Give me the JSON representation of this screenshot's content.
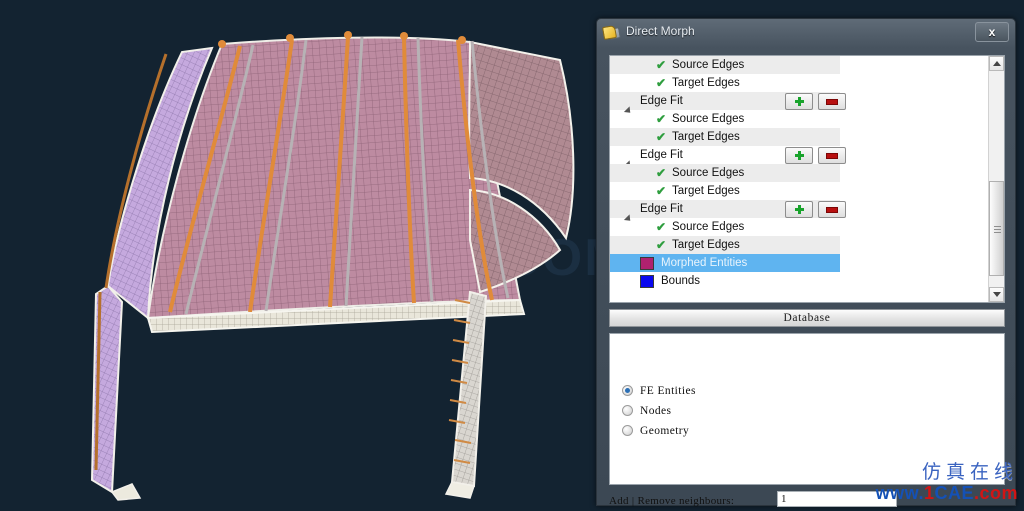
{
  "viewport": {
    "name": "3d-model-viewport",
    "background_color": "#132331",
    "watermark": "CAE.COM",
    "model_description": "FE mesh of an automotive roof / body-in-white panel with side rails",
    "mesh_colors": {
      "shell_panel": "#c08ba0",
      "ribs": "#e08b3a",
      "rails": "#b7aeb8",
      "left_pillar": "#c3a8dc",
      "highlight_edges": "#f2f0ea"
    }
  },
  "dialog": {
    "title": "Direct Morph",
    "icon": "morph-tag-icon",
    "close_label": "x",
    "tree": {
      "rows": [
        {
          "type": "check",
          "indent": 44,
          "label": "Source Edges",
          "alt": true,
          "selected": false
        },
        {
          "type": "check",
          "indent": 44,
          "label": "Target Edges",
          "alt": false,
          "selected": false
        },
        {
          "type": "arrow",
          "indent": 12,
          "label": "Edge Fit",
          "alt": true,
          "selected": false,
          "buttons": [
            "add",
            "remove"
          ]
        },
        {
          "type": "check",
          "indent": 44,
          "label": "Source Edges",
          "alt": false,
          "selected": false
        },
        {
          "type": "check",
          "indent": 44,
          "label": "Target Edges",
          "alt": true,
          "selected": false
        },
        {
          "type": "arrow",
          "indent": 12,
          "label": "Edge Fit",
          "alt": false,
          "selected": false,
          "buttons": [
            "add",
            "remove"
          ]
        },
        {
          "type": "check",
          "indent": 44,
          "label": "Source Edges",
          "alt": true,
          "selected": false
        },
        {
          "type": "check",
          "indent": 44,
          "label": "Target Edges",
          "alt": false,
          "selected": false
        },
        {
          "type": "arrow",
          "indent": 12,
          "label": "Edge Fit",
          "alt": true,
          "selected": false,
          "buttons": [
            "add",
            "remove"
          ]
        },
        {
          "type": "check",
          "indent": 44,
          "label": "Source Edges",
          "alt": false,
          "selected": false
        },
        {
          "type": "check",
          "indent": 44,
          "label": "Target Edges",
          "alt": true,
          "selected": false
        },
        {
          "type": "swatch",
          "indent": 30,
          "label": "Morphed Entities",
          "alt": false,
          "selected": true,
          "color": "#b0216f"
        },
        {
          "type": "swatch",
          "indent": 30,
          "label": "Bounds",
          "alt": false,
          "selected": false,
          "color": "#0a08f0"
        }
      ],
      "scrollbar": {
        "up_icon": "caret-up-icon",
        "down_icon": "caret-down-icon"
      }
    },
    "database_button": "Database",
    "options": {
      "selected": "FE Entities",
      "items": [
        {
          "label": "FE Entities",
          "checked": true
        },
        {
          "label": "Nodes",
          "checked": false
        },
        {
          "label": "Geometry",
          "checked": false
        }
      ]
    },
    "neighbours": {
      "label": "Add | Remove neighbours:",
      "value": "1",
      "placeholder": ""
    }
  },
  "watermark": {
    "chinese": "仿真在线",
    "site_prefix": "www.",
    "site_one": "1",
    "site_cae": "CAE",
    "site_suffix": ".com"
  }
}
